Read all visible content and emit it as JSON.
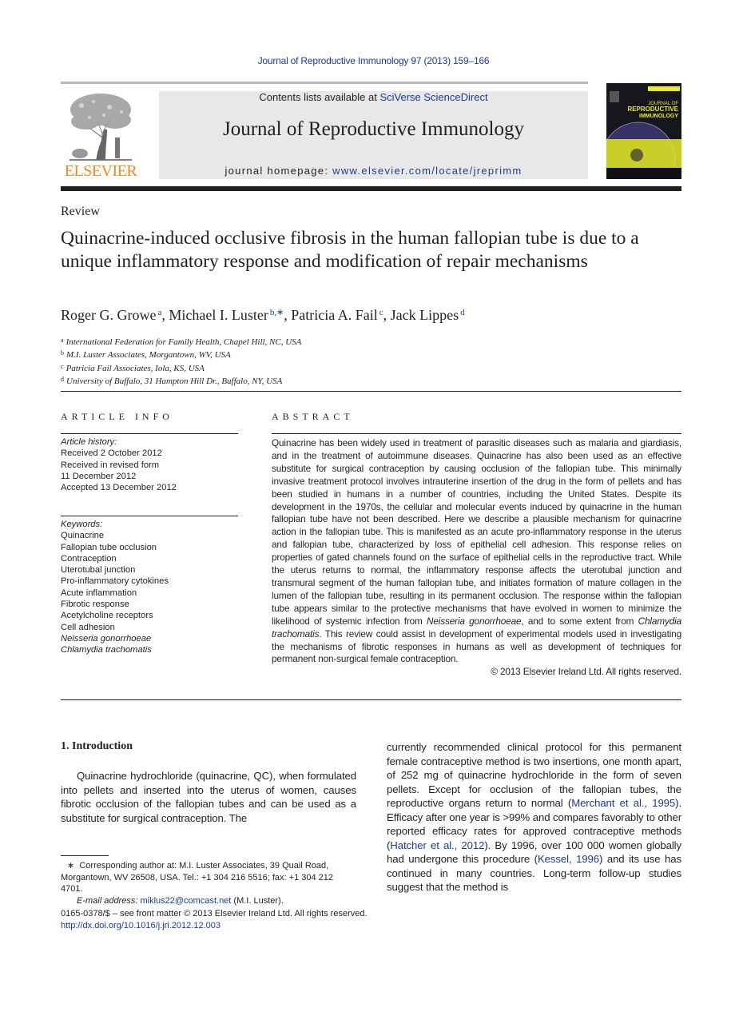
{
  "header": {
    "journal_ref": "Journal of Reproductive Immunology 97 (2013) 159–166",
    "contents_prefix": "Contents lists available at ",
    "contents_link": "SciVerse ScienceDirect",
    "journal_title": "Journal of Reproductive Immunology",
    "homepage_prefix": "journal homepage: ",
    "homepage_link": "www.elsevier.com/locate/jreprimm",
    "publisher_logo_text": "ELSEVIER",
    "cover_title_1": "JOURNAL OF",
    "cover_title_2": "REPRODUCTIVE",
    "cover_title_3": "IMMUNOLOGY"
  },
  "article": {
    "type": "Review",
    "title": "Quinacrine-induced occlusive fibrosis in the human fallopian tube is due to a unique inflammatory response and modification of repair mechanisms",
    "authors": [
      {
        "name": "Roger G. Growe",
        "sup": "a"
      },
      {
        "name": "Michael I. Luster",
        "sup": "b,∗"
      },
      {
        "name": "Patricia A. Fail",
        "sup": "c"
      },
      {
        "name": "Jack Lippes",
        "sup": "d"
      }
    ],
    "affiliations": [
      {
        "key": "a",
        "text": "International Federation for Family Health, Chapel Hill, NC, USA"
      },
      {
        "key": "b",
        "text": "M.I. Luster Associates, Morgantown, WV, USA"
      },
      {
        "key": "c",
        "text": "Patricia Fail Associates, Iola, KS, USA"
      },
      {
        "key": "d",
        "text": "University of Buffalo, 31 Hampton Hill Dr., Buffalo, NY, USA"
      }
    ]
  },
  "article_info": {
    "heading": "ARTICLE INFO",
    "history_label": "Article history:",
    "history": [
      "Received 2 October 2012",
      "Received in revised form",
      "11 December 2012",
      "Accepted 13 December 2012"
    ],
    "keywords_label": "Keywords:",
    "keywords": [
      {
        "text": "Quinacrine",
        "italic": false
      },
      {
        "text": "Fallopian tube occlusion",
        "italic": false
      },
      {
        "text": "Contraception",
        "italic": false
      },
      {
        "text": "Uterotubal junction",
        "italic": false
      },
      {
        "text": "Pro-inflammatory cytokines",
        "italic": false
      },
      {
        "text": "Acute inflammation",
        "italic": false
      },
      {
        "text": "Fibrotic response",
        "italic": false
      },
      {
        "text": "Acetylcholine receptors",
        "italic": false
      },
      {
        "text": "Cell adhesion",
        "italic": false
      },
      {
        "text": "Neisseria gonorrhoeae",
        "italic": true
      },
      {
        "text": "Chlamydia trachomatis",
        "italic": true
      }
    ]
  },
  "abstract": {
    "heading": "ABSTRACT",
    "part1": "Quinacrine has been widely used in treatment of parasitic diseases such as malaria and giardiasis, and in the treatment of autoimmune diseases. Quinacrine has also been used as an effective substitute for surgical contraception by causing occlusion of the fallopian tube. This minimally invasive treatment protocol involves intrauterine insertion of the drug in the form of pellets and has been studied in humans in a number of countries, including the United States. Despite its development in the 1970s, the cellular and molecular events induced by quinacrine in the human fallopian tube have not been described. Here we describe a plausible mechanism for quinacrine action in the fallopian tube. This is manifested as an acute pro-inflammatory response in the uterus and fallopian tube, characterized by loss of epithelial cell adhesion. This response relies on properties of gated channels found on the surface of epithelial cells in the reproductive tract. While the uterus returns to normal, the inflammatory response affects the uterotubal junction and transmural segment of the human fallopian tube, and initiates formation of mature collagen in the lumen of the fallopian tube, resulting in its permanent occlusion. The response within the fallopian tube appears similar to the protective mechanisms that have evolved in women to minimize the likelihood of systemic infection from ",
    "italic1": "Neisseria gonorrhoeae",
    "part2": ", and to some extent from ",
    "italic2": "Chlamydia trachomatis",
    "part3": ". This review could assist in development of experimental models used in investigating the mechanisms of fibrotic responses in humans as well as development of techniques for permanent non-surgical female contraception.",
    "copyright": "© 2013 Elsevier Ireland Ltd. All rights reserved."
  },
  "body": {
    "section_heading": "1.  Introduction",
    "left_para": "Quinacrine hydrochloride (quinacrine, QC), when formulated into pellets and inserted into the uterus of women, causes fibrotic occlusion of the fallopian tubes and can be used as a substitute for surgical contraception. The",
    "right_1": "currently recommended clinical protocol for this permanent female contraceptive method is two insertions, one month apart, of 252 mg of quinacrine hydrochloride in the form of seven pellets. Except for occlusion of the fallopian tubes, the reproductive organs return to normal (",
    "right_cite1": "Merchant et al., 1995",
    "right_2": "). Efficacy after one year is >99% and compares favorably to other reported efficacy rates for approved contraceptive methods (",
    "right_cite2": "Hatcher et al., 2012",
    "right_3": "). By 1996, over 100 000 women globally had undergone this procedure (",
    "right_cite3": "Kessel, 1996",
    "right_4": ") and its use has continued in many countries. Long-term follow-up studies suggest that the method is"
  },
  "footnote": {
    "marker": "∗",
    "text": "Corresponding author at: M.I. Luster Associates, 39 Quail Road, Morgantown, WV 26508, USA. Tel.: +1 304 216 5516; fax: +1 304 212 4701.",
    "email_label": "E-mail address:",
    "email": "miklus22@comcast.net",
    "email_suffix": " (M.I. Luster)."
  },
  "footer": {
    "issn_line": "0165-0378/$ – see front matter © 2013 Elsevier Ireland Ltd. All rights reserved.",
    "doi": "http://dx.doi.org/10.1016/j.jri.2012.12.003"
  }
}
